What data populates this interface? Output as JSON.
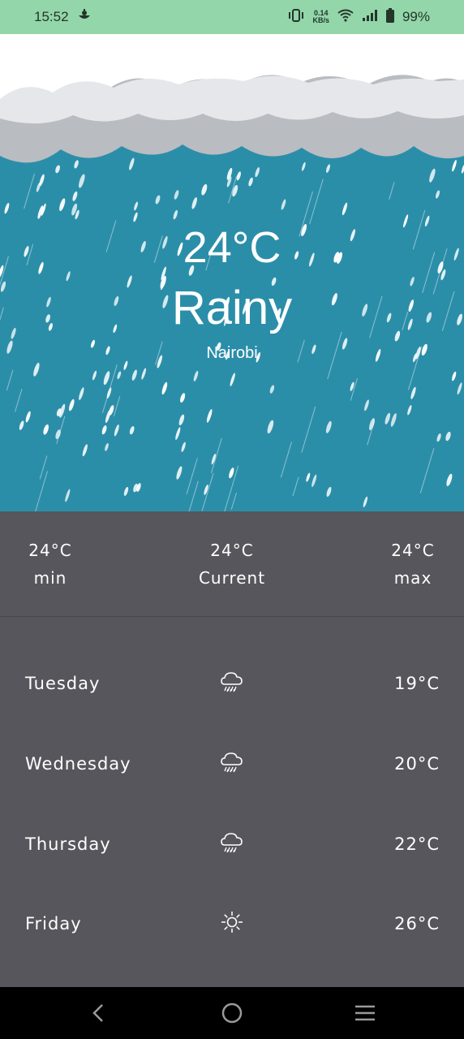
{
  "status_bar": {
    "time": "15:52",
    "notification_icon": "cloud-app-icon",
    "net_speed_value": "0.14",
    "net_speed_unit": "KB/s",
    "battery": "99%"
  },
  "hero": {
    "temperature": "24°C",
    "condition": "Rainy",
    "city": "Nairobi",
    "background_color": "#2b8ea9"
  },
  "summary": {
    "min": {
      "value": "24°C",
      "label": "min"
    },
    "current": {
      "value": "24°C",
      "label": "Current"
    },
    "max": {
      "value": "24°C",
      "label": "max"
    }
  },
  "forecast": [
    {
      "day": "Tuesday",
      "icon": "rain-cloud-icon",
      "temp": "19°C"
    },
    {
      "day": "Wednesday",
      "icon": "rain-cloud-icon",
      "temp": "20°C"
    },
    {
      "day": "Thursday",
      "icon": "rain-cloud-icon",
      "temp": "22°C"
    },
    {
      "day": "Friday",
      "icon": "sun-icon",
      "temp": "26°C"
    }
  ],
  "nav": {
    "back_icon": "back-icon",
    "home_icon": "home-icon",
    "menu_icon": "menu-icon"
  }
}
